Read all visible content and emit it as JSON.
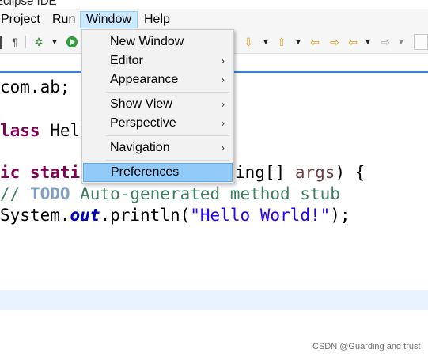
{
  "window": {
    "title": "Eclipse IDE"
  },
  "menubar": {
    "items": [
      {
        "label": "Project"
      },
      {
        "label": "Run"
      },
      {
        "label": "Window"
      },
      {
        "label": "Help"
      }
    ]
  },
  "toolbar": {
    "icons": [
      "pilcrow-icon",
      "bug-icon",
      "run-icon",
      "next-annotation-icon",
      "previous-annotation-icon",
      "last-edit-icon",
      "back-icon",
      "forward-icon",
      "open-perspective-icon"
    ]
  },
  "window_menu": {
    "items": [
      {
        "label": "New Window",
        "submenu": false
      },
      {
        "label": "Editor",
        "submenu": true
      },
      {
        "label": "Appearance",
        "submenu": true
      },
      {
        "label": "Show View",
        "submenu": true
      },
      {
        "label": "Perspective",
        "submenu": true
      },
      {
        "label": "Navigation",
        "submenu": true
      },
      {
        "label": "Preferences",
        "submenu": false,
        "selected": true
      }
    ],
    "submenu_arrow": "›"
  },
  "editor": {
    "lines": {
      "l1": "com.ab;",
      "l2_kw": "lass",
      "l2_rest": " Hell",
      "l3_kw": "ic static",
      "l3_mid": "ing[] ",
      "l3_var": "args",
      "l3_end": ") {",
      "l4_prefix": "// ",
      "l4_todo": "TODO",
      "l4_rest": " Auto-generated method stub",
      "l5_a": "System.",
      "l5_out": "out",
      "l5_b": ".println(",
      "l5_str": "\"Hello World!\"",
      "l5_c": ");"
    }
  },
  "watermark": "CSDN @Guarding and trust",
  "colors": {
    "keyword": "#7f0055",
    "comment": "#3f7f5f",
    "string": "#2a00ff",
    "menu_selected": "#91c9f7",
    "menubar_active": "#cce8ff"
  }
}
